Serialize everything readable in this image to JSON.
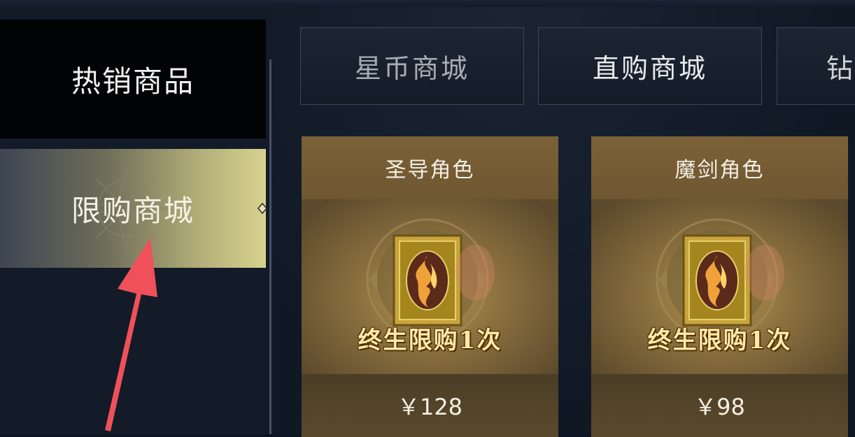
{
  "sidebar": {
    "items": [
      {
        "label": "热销商品",
        "selected": false
      },
      {
        "label": "限购商城",
        "selected": true
      }
    ]
  },
  "tabs": [
    {
      "label": "星币商城"
    },
    {
      "label": "直购商城"
    },
    {
      "label": "钻"
    }
  ],
  "products": [
    {
      "title": "圣导角色",
      "badge": "终生限购1次",
      "price": "￥128",
      "icon": "character-card-icon"
    },
    {
      "title": "魔剑角色",
      "badge": "终生限购1次",
      "price": "￥98",
      "icon": "character-card-icon"
    }
  ],
  "colors": {
    "background": "#0d1522",
    "selected_nav": "#d6d28e",
    "card_gold": "#7c6236",
    "annotation_arrow": "#f0505a"
  }
}
